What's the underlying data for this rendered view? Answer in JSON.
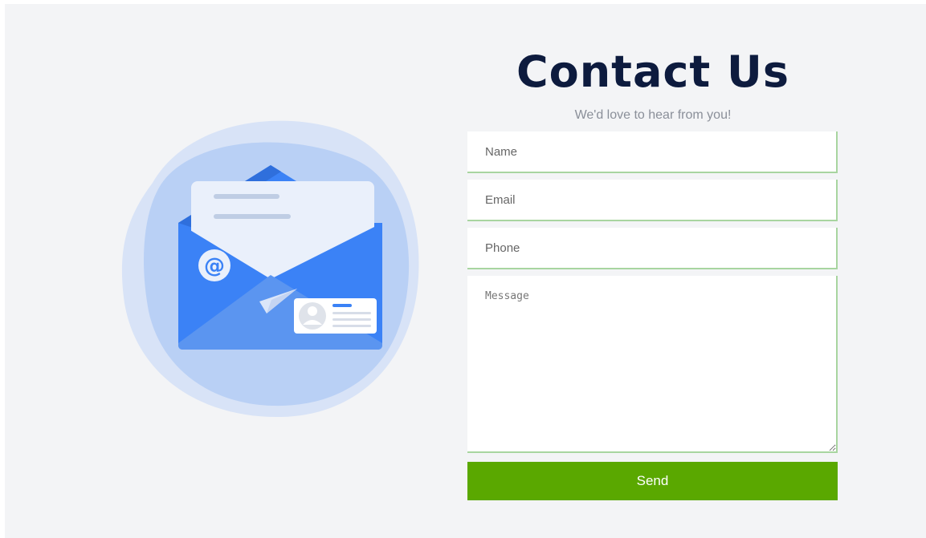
{
  "header": {
    "title": "Contact Us",
    "subtitle": "We'd love to hear from you!"
  },
  "form": {
    "name_placeholder": "Name",
    "email_placeholder": "Email",
    "phone_placeholder": "Phone",
    "message_placeholder": "Message",
    "send_label": "Send"
  },
  "illustration": {
    "icon": "open-envelope-icon",
    "email_symbol": "@"
  },
  "colors": {
    "title": "#0d1b3e",
    "send_button": "#5aa800",
    "field_border": "#a8d5a0",
    "envelope_blue": "#3b82f6",
    "blob_light": "#d6e2f7"
  }
}
